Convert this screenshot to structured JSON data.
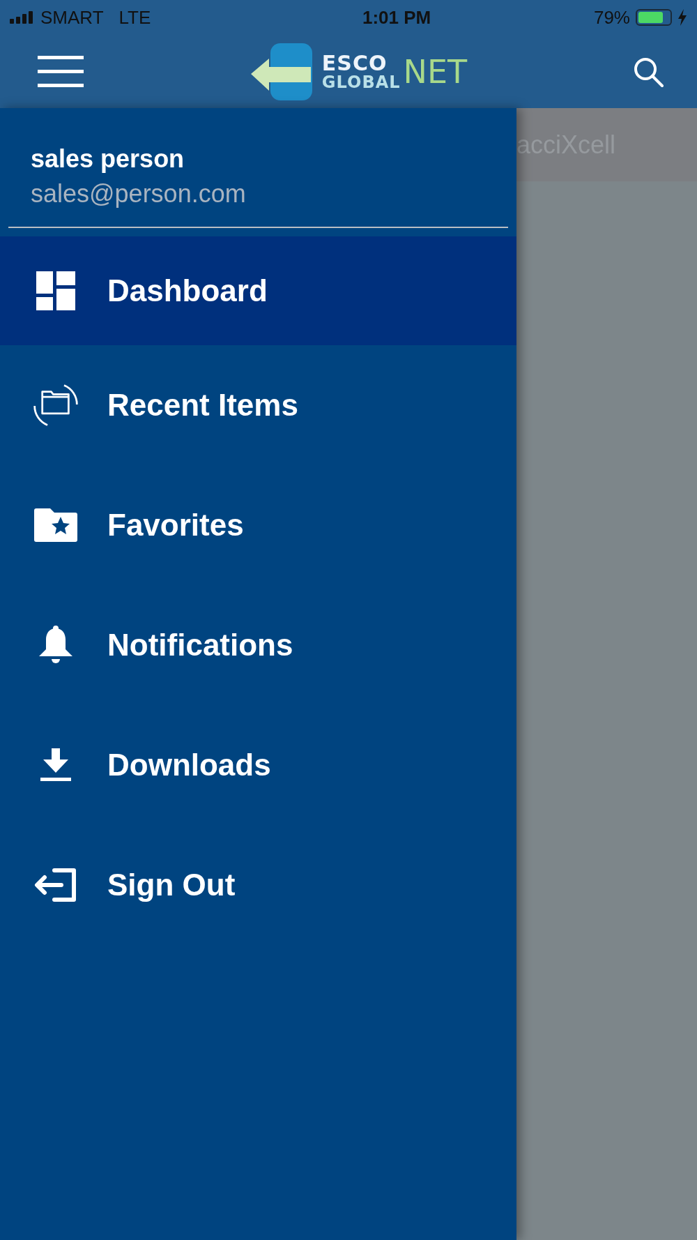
{
  "status_bar": {
    "carrier": "SMART",
    "network": "LTE",
    "time": "1:01 PM",
    "battery": "79%"
  },
  "header": {
    "logo": {
      "line1": "ESCO",
      "line2": "GLOBAL",
      "suffix": "NET"
    }
  },
  "background_page": {
    "title": "acciXcell"
  },
  "drawer": {
    "user": {
      "name": "sales person",
      "email": "sales@person.com"
    },
    "items": [
      {
        "kind": "dashboard",
        "label": "Dashboard",
        "selected": true
      },
      {
        "kind": "recent",
        "label": "Recent Items",
        "selected": false
      },
      {
        "kind": "favorites",
        "label": "Favorites",
        "selected": false
      },
      {
        "kind": "notifications",
        "label": "Notifications",
        "selected": false
      },
      {
        "kind": "downloads",
        "label": "Downloads",
        "selected": false
      },
      {
        "kind": "signout",
        "label": "Sign Out",
        "selected": false
      }
    ]
  }
}
